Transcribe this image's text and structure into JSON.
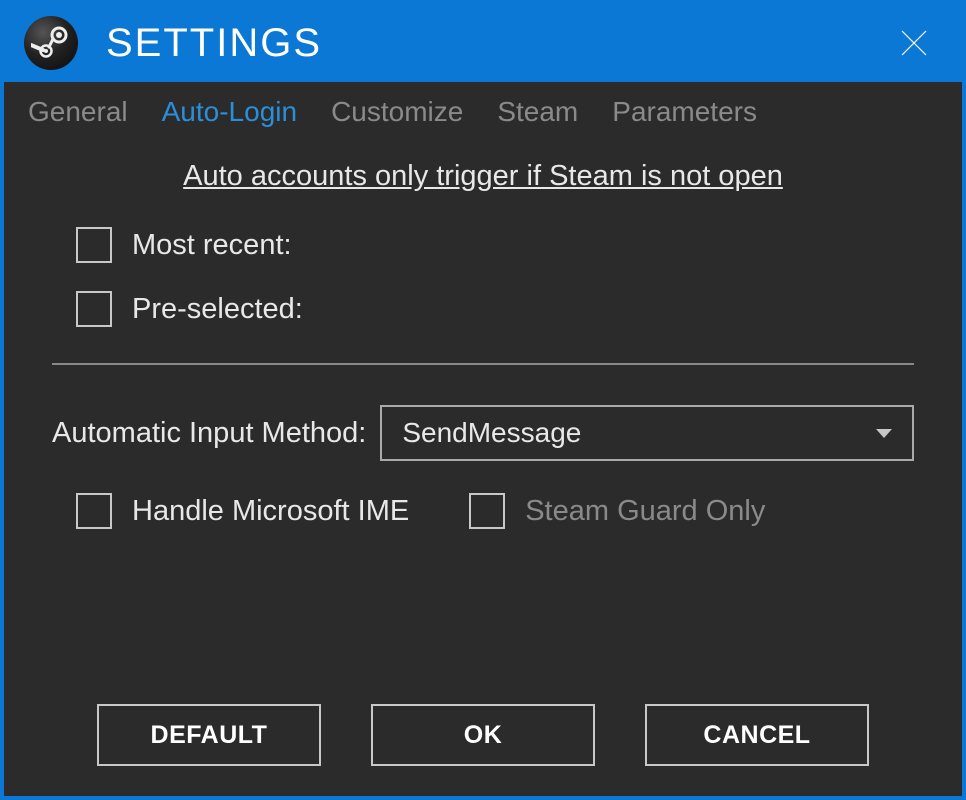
{
  "window": {
    "title": "SETTINGS"
  },
  "tabs": {
    "general": "General",
    "autologin": "Auto-Login",
    "customize": "Customize",
    "steam": "Steam",
    "parameters": "Parameters"
  },
  "content": {
    "info": "Auto accounts only trigger if Steam is not open",
    "most_recent": "Most recent:",
    "pre_selected": "Pre-selected:",
    "input_method_label": "Automatic Input Method:",
    "input_method_value": "SendMessage",
    "handle_ime": "Handle Microsoft IME",
    "steam_guard_only": "Steam Guard Only"
  },
  "buttons": {
    "default": "DEFAULT",
    "ok": "OK",
    "cancel": "CANCEL"
  }
}
